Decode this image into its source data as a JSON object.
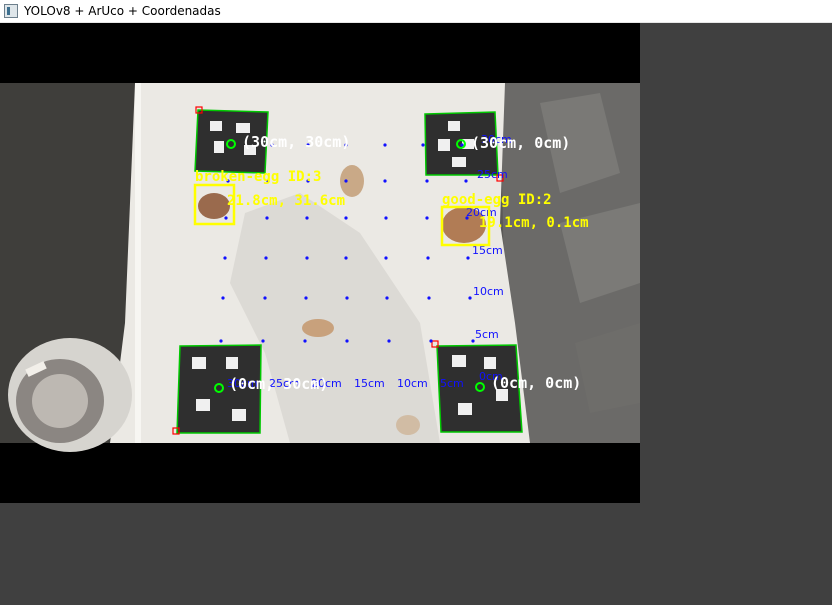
{
  "window": {
    "title": "YOLOv8 + ArUco + Coordenadas",
    "icon": "opencv-window-icon"
  },
  "colors": {
    "aruco_outline": "#00c800",
    "center_marker": "#00ff00",
    "detection_box": "#ffff00",
    "grid_dots": "#1010ff",
    "corner_marker": "#ff0000",
    "label_white": "#ffffff"
  },
  "markers": [
    {
      "label": "(30cm, 30cm)"
    },
    {
      "label": "(30cm, 0cm)"
    },
    {
      "label": "(0cm, 30cm)"
    },
    {
      "label": "(0cm, 0cm)"
    }
  ],
  "detections": [
    {
      "name": "broken-egg ID:3",
      "coords": "21.8cm, 31.6cm"
    },
    {
      "name": "good-egg ID:2",
      "coords": "19.1cm, 0.1cm"
    }
  ],
  "scale_labels": {
    "vertical": [
      "30cm",
      "25cm",
      "20cm",
      "15cm",
      "10cm",
      "5cm",
      "0cm"
    ],
    "horizontal": [
      "30cm",
      "25cm",
      "20cm",
      "15cm",
      "10cm",
      "5cm"
    ]
  }
}
